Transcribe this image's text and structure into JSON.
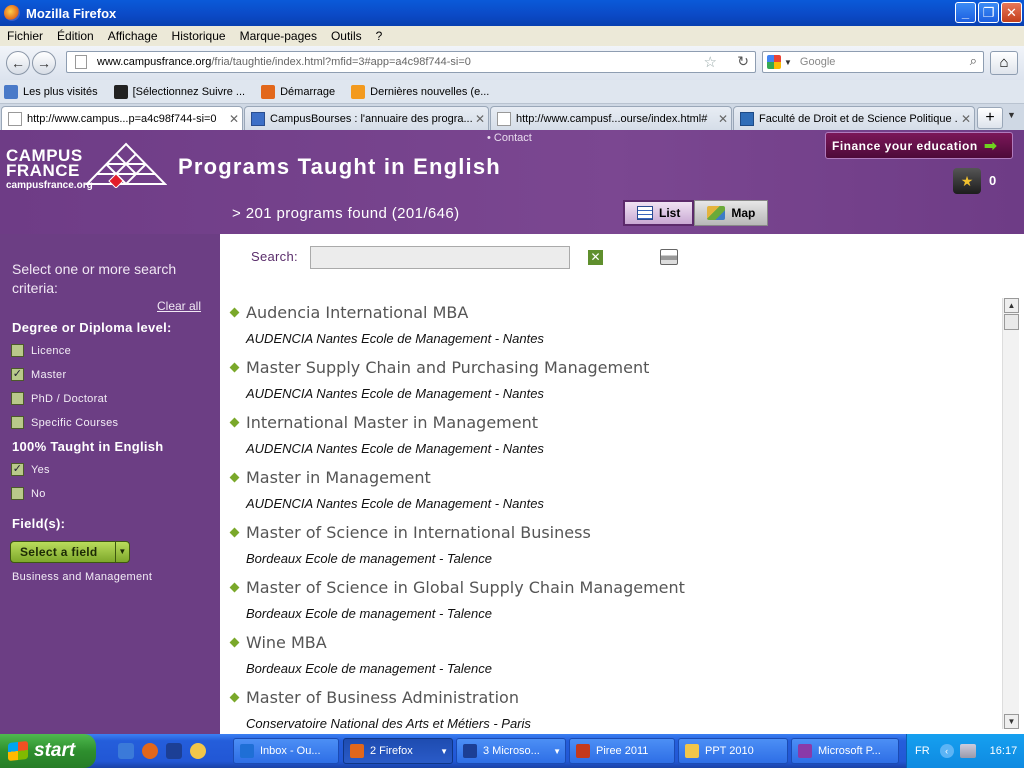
{
  "window": {
    "title": "Mozilla Firefox",
    "buttons": [
      "_",
      "❐",
      "✕"
    ]
  },
  "menu": [
    "Fichier",
    "Édition",
    "Affichage",
    "Historique",
    "Marque-pages",
    "Outils",
    "?"
  ],
  "nav": {
    "url_host": "www.campusfrance.org",
    "url_path": "/fria/taughtie/index.html?mfid=3#app=a4c98f744-si=0",
    "search_placeholder": "Google"
  },
  "bookmarks": [
    {
      "label": "Les plus visités",
      "color": "#4a7ac8"
    },
    {
      "label": "[Sélectionnez Suivre ...",
      "color": "#222222"
    },
    {
      "label": "Démarrage",
      "color": "#e2671b"
    },
    {
      "label": "Dernières nouvelles (e...",
      "color": "#f39a1e"
    }
  ],
  "tabs": [
    {
      "label": "http://www.campus...p=a4c98f744-si=0",
      "active": true
    },
    {
      "label": "CampusBourses : l'annuaire des progra...",
      "active": false
    },
    {
      "label": "http://www.campusf...ourse/index.html#",
      "active": false
    },
    {
      "label": "Faculté de Droit et de Science Politique ...",
      "active": false
    }
  ],
  "site": {
    "contact": "• Contact",
    "logo_line1": "CAMPUS",
    "logo_line2": "FRANCE",
    "logo_url": "campusfrance.org",
    "title": "Programs Taught in English",
    "finance_button": "Finance your education",
    "basket_count": "0",
    "found_text": "> 201 programs found (201/646)",
    "view_list": "List",
    "view_map": "Map",
    "accent_color": "#6e3c86"
  },
  "sidebar": {
    "intro": "Select one or more search criteria:",
    "clear_all": "Clear all",
    "degree_heading": "Degree or Diploma level:",
    "degree_options": [
      {
        "label": "Licence",
        "checked": false
      },
      {
        "label": "Master",
        "checked": true
      },
      {
        "label": "PhD / Doctorat",
        "checked": false
      },
      {
        "label": "Specific Courses",
        "checked": false
      }
    ],
    "english_heading": "100% Taught in English",
    "english_options": [
      {
        "label": "Yes",
        "checked": true
      },
      {
        "label": "No",
        "checked": false
      }
    ],
    "fields_heading": "Field(s):",
    "select_field_button": "Select a field",
    "selected_field": "Business and Management"
  },
  "main": {
    "search_label": "Search:",
    "search_value": "",
    "results": [
      {
        "name": "Audencia International MBA",
        "school": "AUDENCIA Nantes Ecole de Management - Nantes"
      },
      {
        "name": "Master Supply Chain and Purchasing Management",
        "school": "AUDENCIA Nantes Ecole de Management - Nantes"
      },
      {
        "name": "International Master in Management",
        "school": "AUDENCIA Nantes Ecole de Management - Nantes"
      },
      {
        "name": "Master in Management",
        "school": "AUDENCIA Nantes Ecole de Management - Nantes"
      },
      {
        "name": "Master of Science in International Business",
        "school": "Bordeaux Ecole de management - Talence"
      },
      {
        "name": "Master of Science in Global Supply Chain Management",
        "school": "Bordeaux Ecole de management - Talence"
      },
      {
        "name": "Wine MBA",
        "school": "Bordeaux Ecole de management - Talence"
      },
      {
        "name": "Master of Business Administration",
        "school": "Conservatoire National des Arts et Métiers - Paris"
      }
    ]
  },
  "taskbar": {
    "start": "start",
    "tasks": [
      {
        "label": "Inbox - Ou...",
        "color": "#1f6fd6",
        "active": false
      },
      {
        "label": "2 Firefox",
        "color": "#e2671b",
        "active": true
      },
      {
        "label": "3 Microso...",
        "color": "#1c3f95",
        "active": false
      },
      {
        "label": "Piree 2011",
        "color": "#c4391d",
        "active": false
      },
      {
        "label": "PPT 2010",
        "color": "#f2c64a",
        "active": false
      },
      {
        "label": "Microsoft P...",
        "color": "#8a3aa8",
        "active": false
      }
    ],
    "lang": "FR",
    "clock": "16:17"
  }
}
